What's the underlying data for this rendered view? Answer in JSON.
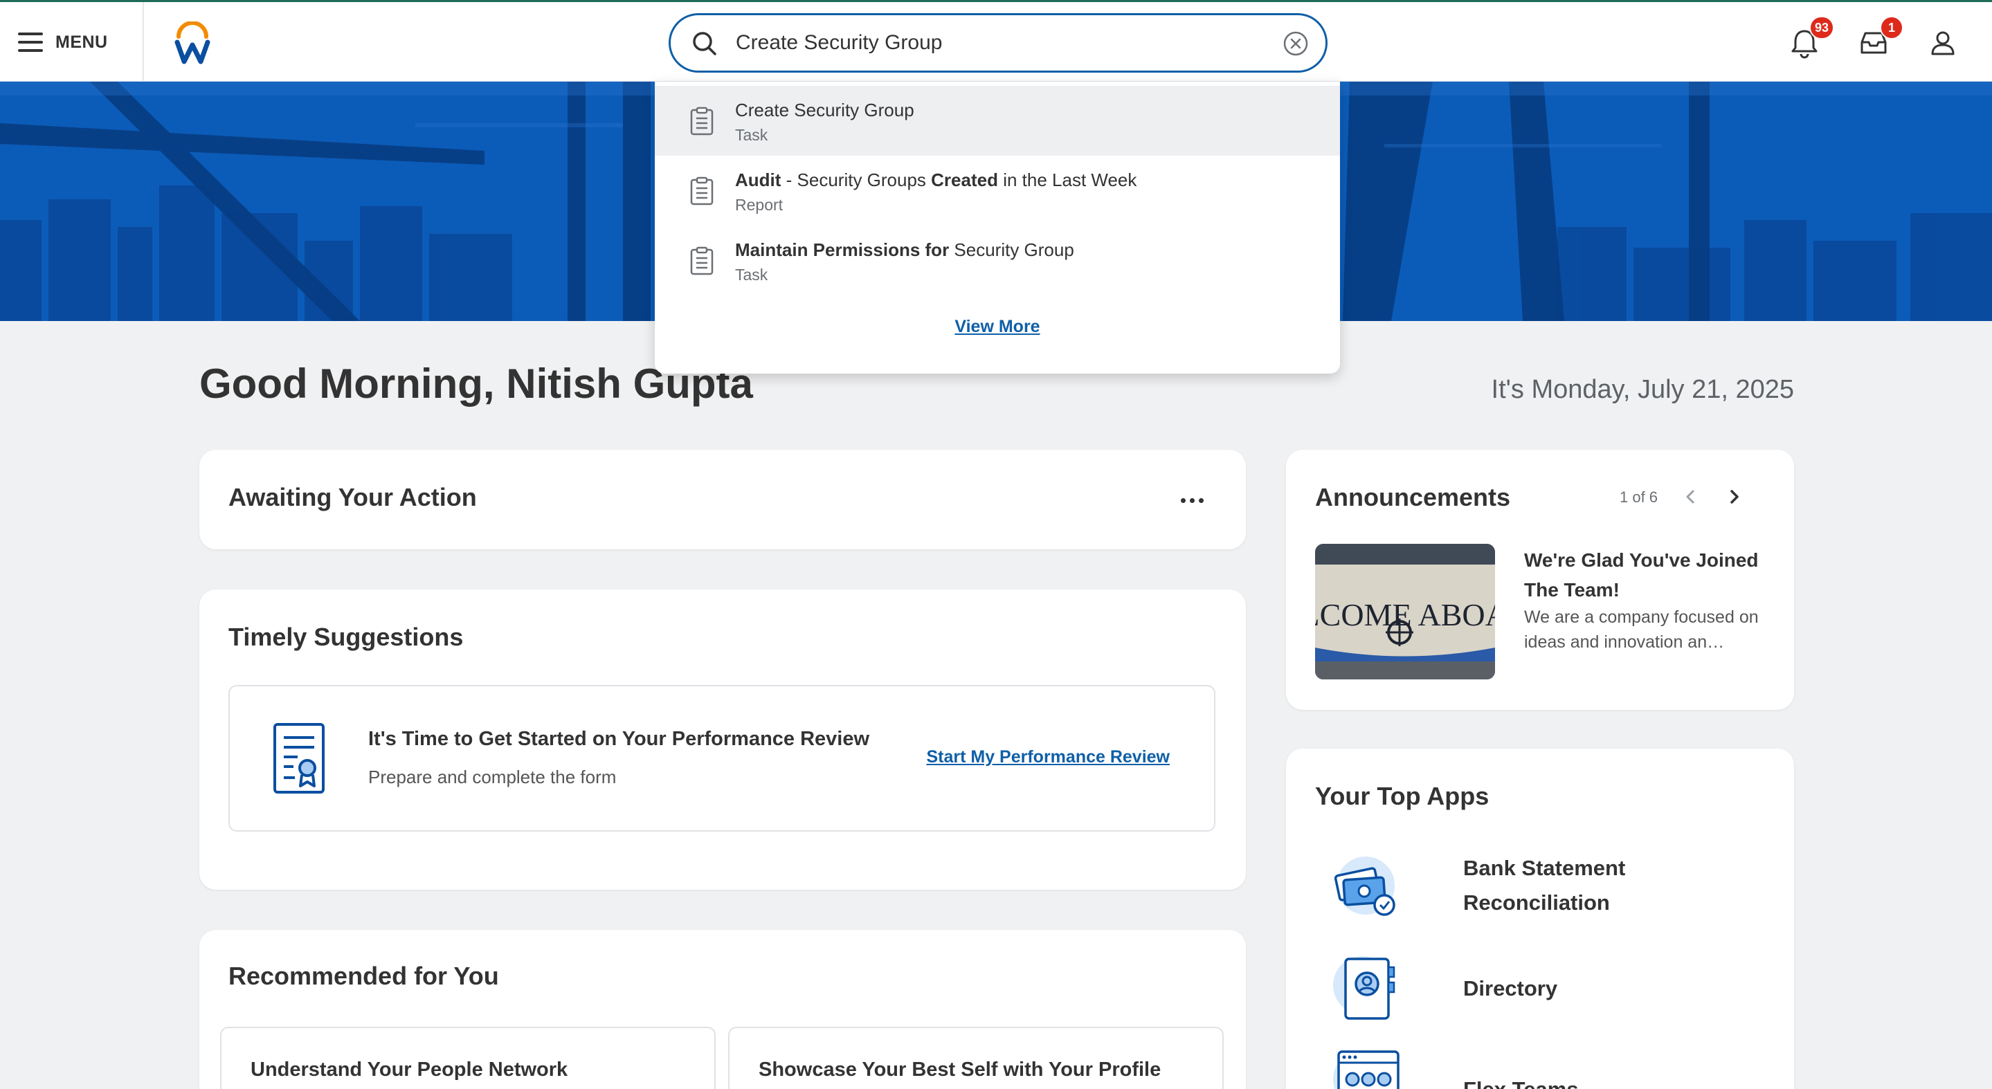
{
  "header": {
    "menu_label": "MENU",
    "search_value": "Create Security Group",
    "notifications_count": "93",
    "inbox_count": "1"
  },
  "search_results": {
    "items": [
      {
        "title_plain": "Create Security Group",
        "type": "Task"
      },
      {
        "title_bold_1": "Audit",
        "title_plain_1": " - Security Groups ",
        "title_bold_2": "Created",
        "title_plain_2": " in the Last Week",
        "type": "Report"
      },
      {
        "title_bold_1": "Maintain Permissions for",
        "title_plain_1": " Security Group",
        "type": "Task"
      }
    ],
    "view_more": "View More"
  },
  "greeting": "Good Morning, Nitish Gupta",
  "date": "It's Monday, July 21, 2025",
  "awaiting": {
    "title": "Awaiting Your Action"
  },
  "timely": {
    "title": "Timely Suggestions",
    "suggestion_title": "It's Time to Get Started on Your Performance Review",
    "suggestion_sub": "Prepare and complete the form",
    "suggestion_link": "Start My Performance Review"
  },
  "recommended": {
    "title": "Recommended for You",
    "tiles": [
      "Understand Your People Network",
      "Showcase Your Best Self with Your Profile"
    ]
  },
  "announcements": {
    "title": "Announcements",
    "pager": "1 of 6",
    "item_title": "We're Glad You've Joined The Team!",
    "item_desc": "We are a company focused on ideas and innovation an…",
    "image_text": "ELCOME ABOAR"
  },
  "top_apps": {
    "title": "Your Top Apps",
    "apps": [
      "Bank Statement Reconciliation",
      "Directory",
      "Flex Teams"
    ]
  },
  "colors": {
    "primary_blue": "#0f5fa8",
    "hero_blue": "#0b5cb8",
    "badge_red": "#de2a1b",
    "logo_orange": "#f38b00",
    "logo_blue": "#0a4fa0"
  }
}
